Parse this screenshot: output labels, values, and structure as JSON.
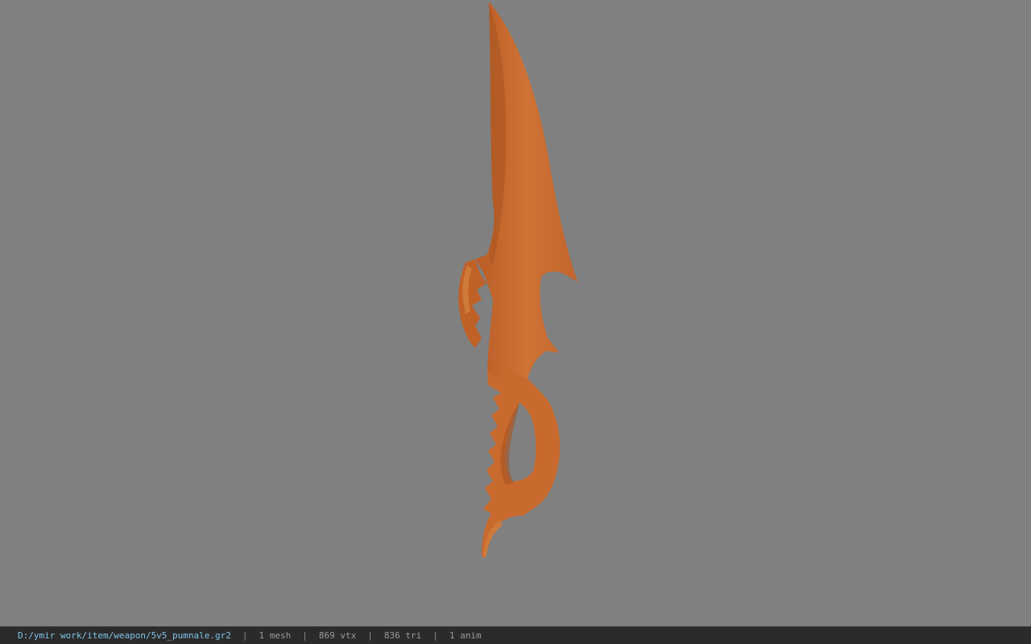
{
  "viewer": {
    "background_color": "#808080",
    "model_color": "#c8692e",
    "model_shadow_color": "#a8531f",
    "model_highlight_color": "#d9803f"
  },
  "status": {
    "file_path": "D:/ymir work/item/weapon/5v5_pumnale.gr2",
    "separator": "|",
    "mesh_count": "1 mesh",
    "vertex_count": "869 vtx",
    "triangle_count": "836 tri",
    "anim_count": "1 anim"
  }
}
